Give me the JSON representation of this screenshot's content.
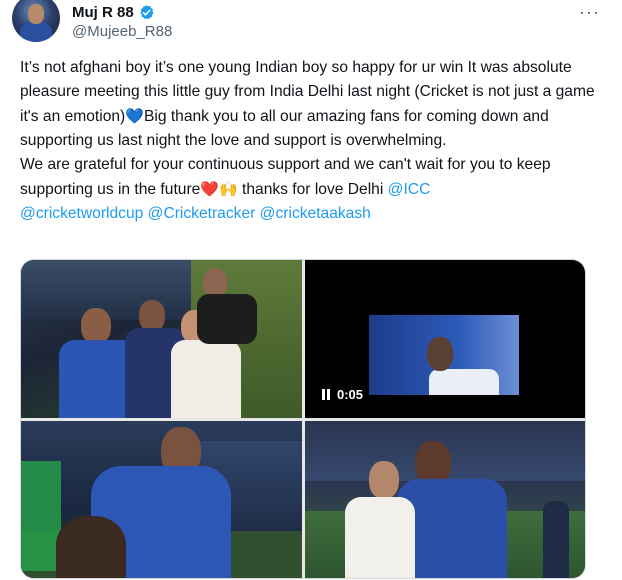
{
  "author": {
    "display_name": "Muj R 88",
    "handle": "@Mujeeb_R88",
    "avatar_icon": "avatar-photo",
    "verified_icon": "verified-badge-icon",
    "verified_color": "#1d9bf0"
  },
  "menu": {
    "more_label": "···"
  },
  "tweet": {
    "segments": [
      {
        "type": "text",
        "value": "It’s not afghani boy it’s one young Indian boy so happy for ur win It was absolute pleasure meeting this little guy from India Delhi last night (Cricket is not just a game it's an emotion)"
      },
      {
        "type": "emoji",
        "value": "💙"
      },
      {
        "type": "text",
        "value": "Big thank you to all our amazing fans for coming down and supporting us last night the love and support is overwhelming.\nWe are grateful for your continuous support and we can't wait for you to keep supporting us in the future"
      },
      {
        "type": "emoji",
        "value": "❤️"
      },
      {
        "type": "emoji",
        "value": "🙌"
      },
      {
        "type": "text",
        "value": " thanks for love Delhi "
      },
      {
        "type": "link",
        "value": "@ICC"
      },
      {
        "type": "text",
        "value": "\n"
      },
      {
        "type": "link",
        "value": "@cricketworldcup"
      },
      {
        "type": "text",
        "value": " "
      },
      {
        "type": "link",
        "value": "@Cricketracker"
      },
      {
        "type": "text",
        "value": " "
      },
      {
        "type": "link",
        "value": "@cricketaakash"
      }
    ]
  },
  "media": {
    "video_time": "0:05",
    "items": [
      {
        "kind": "photo",
        "name": "photo-players-with-boy"
      },
      {
        "kind": "video",
        "name": "video-boy-with-player"
      },
      {
        "kind": "photo",
        "name": "photo-player-hugging-boy"
      },
      {
        "kind": "photo",
        "name": "photo-player-with-boy-stadium"
      }
    ]
  },
  "colors": {
    "text": "#0f1419",
    "secondary": "#536471",
    "link": "#1d9bf0",
    "border": "#cfd9de"
  }
}
